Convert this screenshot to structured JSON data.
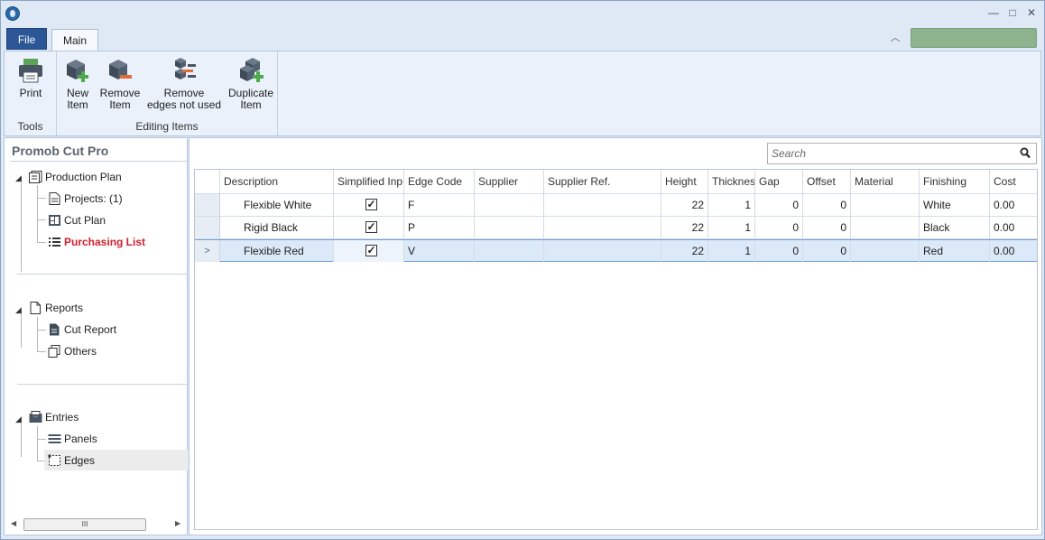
{
  "window": {
    "minimize": "—",
    "maximize": "□",
    "close": "✕"
  },
  "ribbon": {
    "file_tab": "File",
    "main_tab": "Main",
    "collapse": "︿",
    "groups": [
      {
        "label": "Tools",
        "buttons": [
          {
            "label": "Print",
            "icon": "printer-icon"
          }
        ]
      },
      {
        "label": "Editing Items",
        "buttons": [
          {
            "label": "New\nItem",
            "icon": "new-item-icon"
          },
          {
            "label": "Remove\nItem",
            "icon": "remove-item-icon"
          },
          {
            "label": "Remove\nedges not used",
            "icon": "remove-edges-icon"
          },
          {
            "label": "Duplicate\nItem",
            "icon": "duplicate-item-icon"
          }
        ]
      }
    ]
  },
  "sidebar": {
    "title": "Promob Cut Pro",
    "production_plan": "Production Plan",
    "projects": "Projects: (1)",
    "cut_plan": "Cut Plan",
    "purchasing_list": "Purchasing List",
    "reports": "Reports",
    "cut_report": "Cut Report",
    "others": "Others",
    "entries": "Entries",
    "panels": "Panels",
    "edges": "Edges",
    "scroll_thumb": "III"
  },
  "search": {
    "placeholder": "Search"
  },
  "table": {
    "columns": [
      "Description",
      "Simplified Inp",
      "Edge Code",
      "Supplier",
      "Supplier Ref.",
      "Height",
      "Thicknes",
      "Gap",
      "Offset",
      "Material",
      "Finishing",
      "Cost"
    ],
    "rows": [
      {
        "description": "Flexible White",
        "simplified": true,
        "edge_code": "F",
        "supplier": "",
        "supplier_ref": "",
        "height": "22",
        "thickness": "1",
        "gap": "0",
        "offset": "0",
        "material": "",
        "finishing": "White",
        "cost": "0.00"
      },
      {
        "description": "Rigid Black",
        "simplified": true,
        "edge_code": "P",
        "supplier": "",
        "supplier_ref": "",
        "height": "22",
        "thickness": "1",
        "gap": "0",
        "offset": "0",
        "material": "",
        "finishing": "Black",
        "cost": "0.00"
      },
      {
        "description": "Flexible Red",
        "simplified": true,
        "edge_code": "V",
        "supplier": "",
        "supplier_ref": "",
        "height": "22",
        "thickness": "1",
        "gap": "0",
        "offset": "0",
        "material": "",
        "finishing": "Red",
        "cost": "0.00"
      }
    ],
    "selected_row_marker": ">"
  },
  "colors": {
    "accent": "#2b5797",
    "highlight_text": "#d0202e",
    "status_green": "#8db48e"
  }
}
